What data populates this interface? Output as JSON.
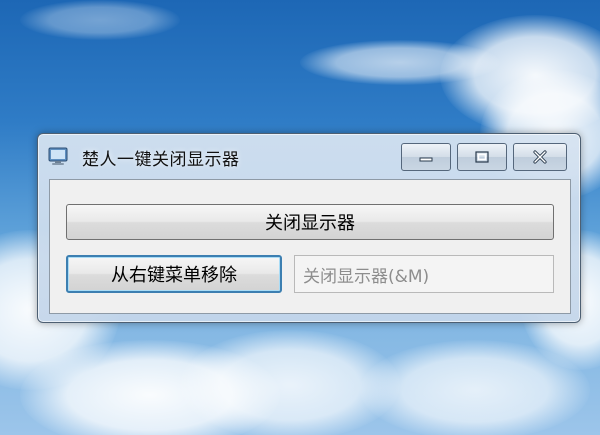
{
  "window": {
    "title": "楚人一键关闭显示器",
    "caption_buttons": {
      "minimize_icon": "minimize-icon",
      "maximize_icon": "maximize-icon",
      "close_icon": "close-icon"
    }
  },
  "main": {
    "close_display_button": "关闭显示器",
    "remove_menu_button": "从右键菜单移除",
    "menu_item_field": "关闭显示器(&M)"
  },
  "colors": {
    "sky": "#2f7cc6",
    "window_frame": "#c4d6ea",
    "focus_border": "#3c7fb1"
  }
}
